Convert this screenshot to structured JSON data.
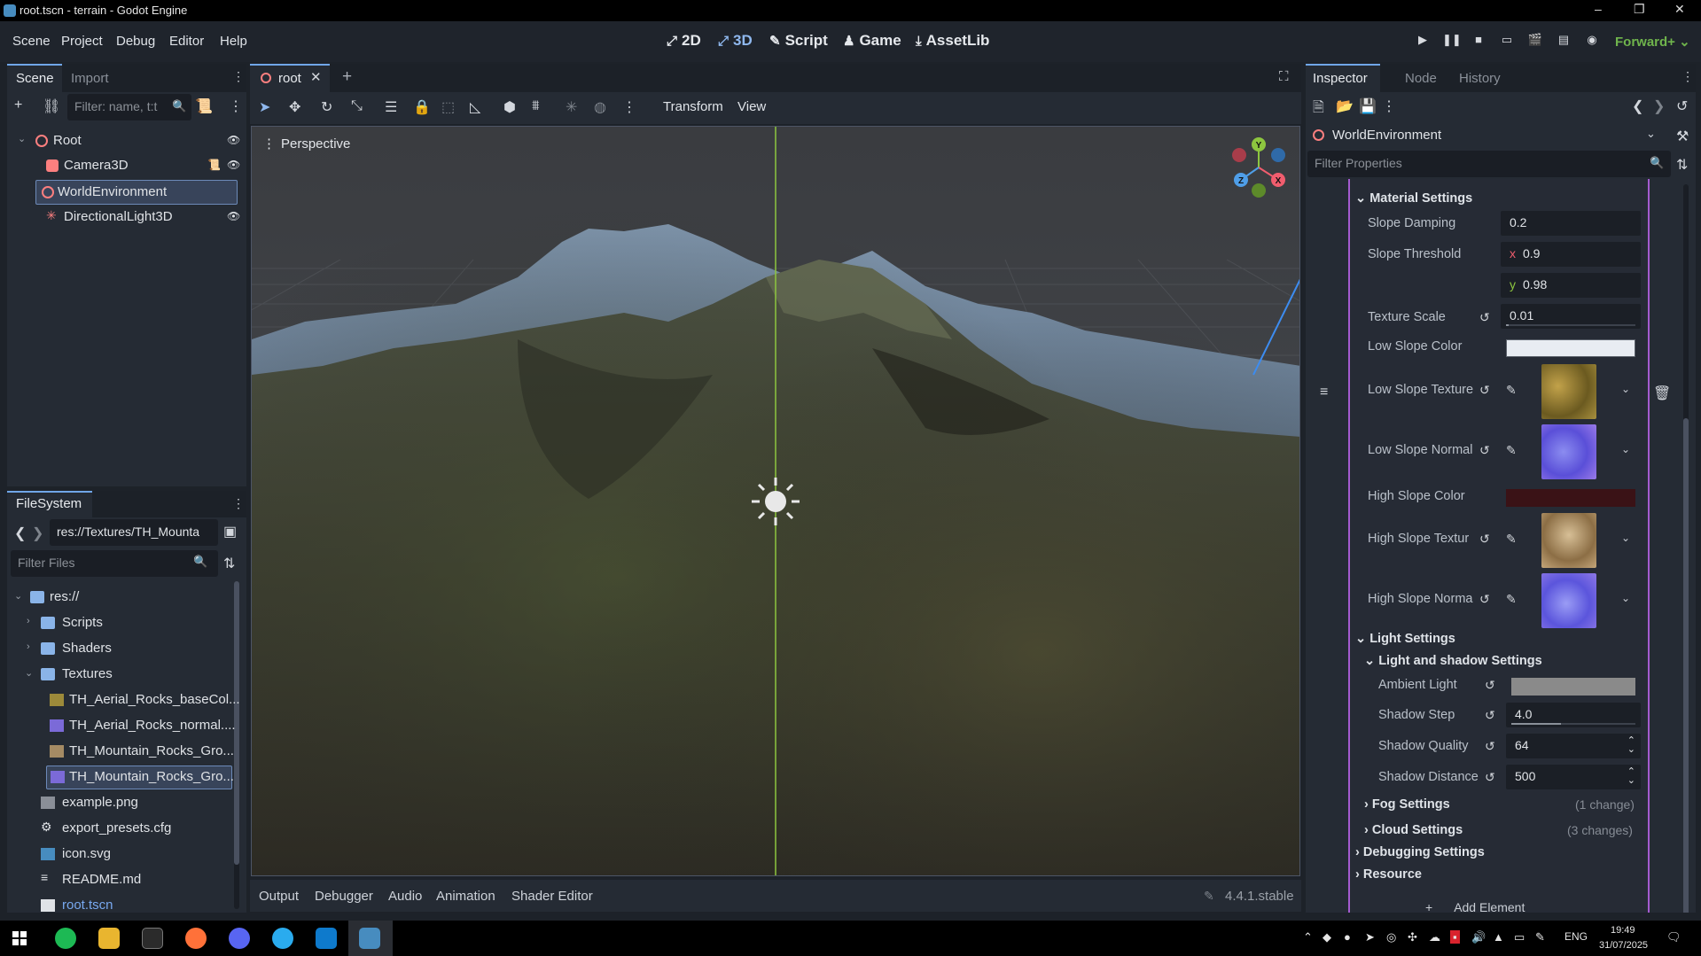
{
  "window": {
    "title": "root.tscn - terrain - Godot Engine",
    "minimize": "–",
    "restore": "❐",
    "close": "✕"
  },
  "menu": [
    "Scene",
    "Project",
    "Debug",
    "Editor",
    "Help"
  ],
  "main_screens": [
    {
      "label": "2D",
      "icon": "2d-icon",
      "glyph": "⤢"
    },
    {
      "label": "3D",
      "icon": "3d-icon",
      "glyph": "⤢",
      "active": true
    },
    {
      "label": "Script",
      "icon": "script-icon",
      "glyph": "✎"
    },
    {
      "label": "Game",
      "icon": "game-icon",
      "glyph": "♟"
    },
    {
      "label": "AssetLib",
      "icon": "assetlib-icon",
      "glyph": "⤓"
    }
  ],
  "renderer": "Forward+",
  "scene_dock": {
    "tabs": [
      "Scene",
      "Import"
    ],
    "filter_placeholder": "Filter: name, t:t",
    "nodes": [
      {
        "name": "Root",
        "icon": "node3d-icon",
        "visible": true
      },
      {
        "name": "Camera3D",
        "icon": "camera3d-icon",
        "visible": true,
        "script": true
      },
      {
        "name": "WorldEnvironment",
        "icon": "worldenvironment-icon",
        "selected": true
      },
      {
        "name": "DirectionalLight3D",
        "icon": "directionallight-icon",
        "visible": true
      }
    ]
  },
  "filesystem_dock": {
    "title": "FileSystem",
    "path": "res://Textures/TH_Mounta",
    "filter_placeholder": "Filter Files",
    "items": [
      {
        "name": "res://",
        "type": "folder",
        "depth": 0,
        "expanded": true
      },
      {
        "name": "Scripts",
        "type": "folder",
        "depth": 1
      },
      {
        "name": "Shaders",
        "type": "folder",
        "depth": 1
      },
      {
        "name": "Textures",
        "type": "folder",
        "depth": 1,
        "expanded": true
      },
      {
        "name": "TH_Aerial_Rocks_baseCol...",
        "type": "texture-color",
        "depth": 2
      },
      {
        "name": "TH_Aerial_Rocks_normal....",
        "type": "texture-normal",
        "depth": 2
      },
      {
        "name": "TH_Mountain_Rocks_Gro...",
        "type": "texture-color",
        "depth": 2
      },
      {
        "name": "TH_Mountain_Rocks_Gro...",
        "type": "texture-normal",
        "depth": 2,
        "selected": true
      },
      {
        "name": "example.png",
        "type": "image",
        "depth": 1
      },
      {
        "name": "export_presets.cfg",
        "type": "config",
        "depth": 1
      },
      {
        "name": "icon.svg",
        "type": "svg",
        "depth": 1
      },
      {
        "name": "README.md",
        "type": "text",
        "depth": 1
      },
      {
        "name": "root.tscn",
        "type": "scene",
        "depth": 1
      }
    ]
  },
  "editor_tabs": [
    {
      "label": "root",
      "active": true
    }
  ],
  "viewport_toolbar": {
    "transform": "Transform",
    "view": "View"
  },
  "viewport": {
    "label": "Perspective",
    "gizmo": {
      "x": "X",
      "y": "Y",
      "z": "Z"
    }
  },
  "bottom_panel": {
    "tabs": [
      "Output",
      "Debugger",
      "Audio",
      "Animation",
      "Shader Editor"
    ],
    "version": "4.4.1.stable"
  },
  "inspector": {
    "tabs": [
      "Inspector",
      "Node",
      "History"
    ],
    "object": "WorldEnvironment",
    "filter_placeholder": "Filter Properties",
    "material_settings": {
      "title": "Material Settings",
      "slope_damping": {
        "label": "Slope Damping",
        "value": "0.2"
      },
      "slope_threshold": {
        "label": "Slope Threshold",
        "x_label": "x",
        "x": "0.9",
        "y_label": "y",
        "y": "0.98"
      },
      "texture_scale": {
        "label": "Texture Scale",
        "value": "0.01",
        "fill": 0.01
      },
      "low_slope_color": {
        "label": "Low Slope Color",
        "color": "#e8ecf2"
      },
      "low_slope_texture": {
        "label": "Low Slope Texture"
      },
      "low_slope_normal": {
        "label": "Low Slope Normal"
      },
      "high_slope_color": {
        "label": "High Slope Color",
        "color": "#3a1216"
      },
      "high_slope_texture": {
        "label": "High Slope Textur"
      },
      "high_slope_normal": {
        "label": "High Slope Norma"
      }
    },
    "light_settings": {
      "title": "Light Settings",
      "sub_title": "Light and shadow Settings",
      "ambient_light": {
        "label": "Ambient Light",
        "color": "#8a8a8a"
      },
      "shadow_step": {
        "label": "Shadow Step",
        "value": "4.0",
        "fill": 0.4
      },
      "shadow_quality": {
        "label": "Shadow Quality",
        "value": "64"
      },
      "shadow_distance": {
        "label": "Shadow Distance",
        "value": "500"
      }
    },
    "fog_settings": {
      "label": "Fog Settings",
      "note": "(1 change)"
    },
    "cloud_settings": {
      "label": "Cloud Settings",
      "note": "(3 changes)"
    },
    "debugging_settings": "Debugging Settings",
    "resource": "Resource",
    "add_element": "Add Element"
  },
  "taskbar": {
    "lang": "ENG",
    "time": "19:49",
    "date": "31/07/2025"
  }
}
